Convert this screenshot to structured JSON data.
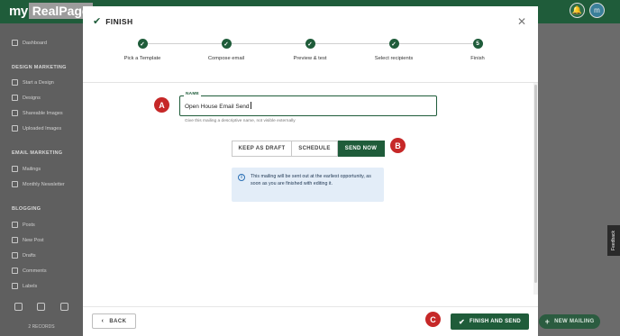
{
  "app": {
    "logo_my": "my",
    "logo_rest": "RealPage",
    "avatar_initials": "m"
  },
  "sidebar": {
    "items_top": [
      {
        "label": "Dashboard"
      }
    ],
    "sections": [
      {
        "title": "DESIGN MARKETING",
        "items": [
          "Start a Design",
          "Designs",
          "Shareable Images",
          "Uploaded Images"
        ]
      },
      {
        "title": "EMAIL MARKETING",
        "items": [
          "Mailings",
          "Monthly Newsletter"
        ]
      },
      {
        "title": "BLOGGING",
        "items": [
          "Posts",
          "New Post",
          "Drafts",
          "Comments",
          "Labels"
        ]
      }
    ],
    "records": "2 RECORDS"
  },
  "modal": {
    "title": "FINISH",
    "steps": [
      {
        "label": "Pick a Template",
        "state": "done"
      },
      {
        "label": "Compose email",
        "state": "done"
      },
      {
        "label": "Preview & test",
        "state": "done"
      },
      {
        "label": "Select recipients",
        "state": "done"
      },
      {
        "label": "Finish",
        "state": "current",
        "number": "5"
      }
    ],
    "name_field": {
      "label": "NAME",
      "value": "Open House Email Send",
      "helper": "Give this mailing a descriptive name, not visible externally"
    },
    "send_options": {
      "keep_draft": "KEEP AS DRAFT",
      "schedule": "SCHEDULE",
      "send_now": "SEND NOW",
      "selected": "SEND NOW"
    },
    "info_message": "This mailing will be sent out at the earliest opportunity, as soon as you are finished with editing it.",
    "markers": {
      "a": "A",
      "b": "B",
      "c": "C"
    },
    "back_label": "BACK",
    "finish_label": "FINISH AND SEND"
  },
  "background": {
    "new_mailing_label": "NEW MAILING",
    "feedback_label": "Feedback"
  },
  "colors": {
    "brand_green": "#1f5c3a",
    "marker_red": "#c62828",
    "info_bg": "#e3edf8"
  }
}
